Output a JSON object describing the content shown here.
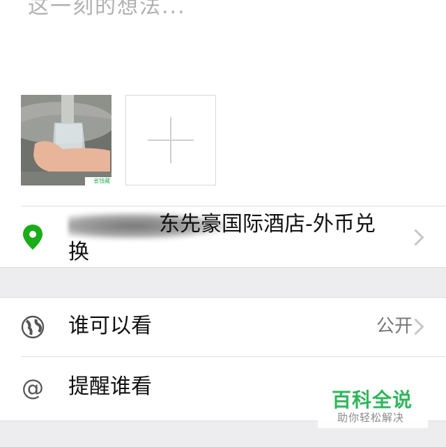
{
  "compose": {
    "text_partial": "这一刻的想法..."
  },
  "photos": [
    {
      "kind": "thumbnail",
      "caption": "省钱藏"
    }
  ],
  "add_photo": {
    "icon": "plus-icon"
  },
  "location": {
    "icon": "location-pin-icon",
    "icon_color": "#1aad19",
    "label": "东先豪国际酒店-外币兑换"
  },
  "visibility": {
    "icon": "globe-icon",
    "label": "谁可以看",
    "value": "公开"
  },
  "remind": {
    "icon": "at-icon",
    "label": "提醒谁看"
  },
  "watermark": {
    "title": "百科全说",
    "subtitle": "助你轻松解决",
    "color": "#2db75a"
  }
}
